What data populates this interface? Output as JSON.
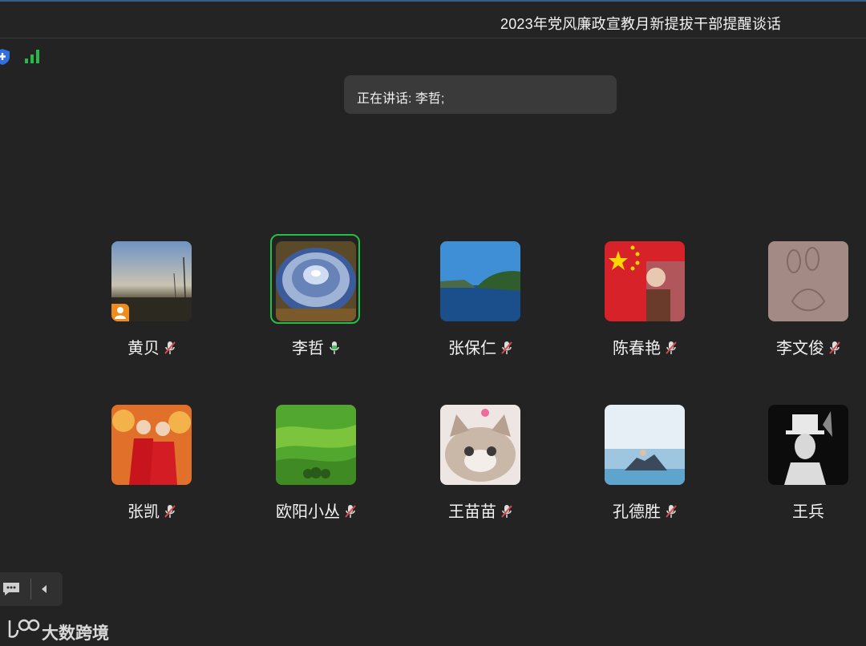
{
  "window": {
    "title": "2023年党风廉政宣教月新提拔干部提醒谈话"
  },
  "status_icons": [
    "shield-icon",
    "signal-strength-icon"
  ],
  "speaker": {
    "text": "正在讲话: 李哲;"
  },
  "participants": [
    {
      "name": "黄贝",
      "mic": "muted",
      "host": true,
      "active": false
    },
    {
      "name": "李哲",
      "mic": "on",
      "host": false,
      "active": true
    },
    {
      "name": "张保仁",
      "mic": "muted",
      "host": false,
      "active": false
    },
    {
      "name": "陈春艳",
      "mic": "muted",
      "host": false,
      "active": false
    },
    {
      "name": "李文俊",
      "mic": "muted",
      "host": false,
      "active": false
    },
    {
      "name": "张凯",
      "mic": "muted",
      "host": false,
      "active": false
    },
    {
      "name": "欧阳小丛",
      "mic": "muted",
      "host": false,
      "active": false
    },
    {
      "name": "王苗苗",
      "mic": "muted",
      "host": false,
      "active": false
    },
    {
      "name": "孔德胜",
      "mic": "muted",
      "host": false,
      "active": false
    },
    {
      "name": "王兵",
      "mic": "none",
      "host": false,
      "active": false
    }
  ],
  "toolbar": {
    "icons": [
      "chat-icon",
      "collapse-arrow-icon"
    ]
  },
  "watermark": {
    "text": "大数跨境"
  },
  "colors": {
    "background": "#232323",
    "active_speaker": "#22c043",
    "host_badge": "#f08c1e",
    "mic_on": "#3cc35a",
    "mic_muted": "#d94a4a"
  }
}
